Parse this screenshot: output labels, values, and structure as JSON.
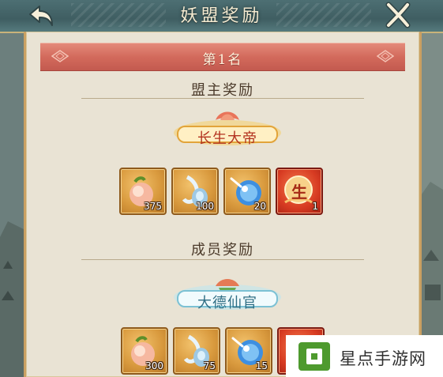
{
  "header": {
    "title": "妖盟奖励",
    "back_icon": "back-arrow-icon",
    "close_icon": "close-x-icon"
  },
  "rank": {
    "label": "第1名"
  },
  "leader_section": {
    "title": "盟主奖励",
    "badge_text": "长生大帝",
    "items": [
      {
        "icon": "peach-icon",
        "count": "375"
      },
      {
        "icon": "water-vase-icon",
        "count": "100"
      },
      {
        "icon": "blue-orb-icon",
        "count": "20"
      },
      {
        "icon": "sheng-seal-icon",
        "glyph": "生",
        "count": "1"
      }
    ]
  },
  "member_section": {
    "title": "成员奖励",
    "badge_text": "大德仙官",
    "items": [
      {
        "icon": "peach-icon",
        "count": "300"
      },
      {
        "icon": "water-vase-icon",
        "count": "75"
      },
      {
        "icon": "blue-orb-icon",
        "count": "15"
      },
      {
        "icon": "red-reward-icon",
        "count": ""
      }
    ]
  },
  "watermark": {
    "text": "星点手游网"
  },
  "colors": {
    "panel_bg": "#e9e3d4",
    "rank_banner": "#d36a5c",
    "gold_frame": "#d99a3e",
    "red_frame": "#d73b22",
    "header_bg": "#4d6f73",
    "watermark_green": "#4e9a2e"
  }
}
